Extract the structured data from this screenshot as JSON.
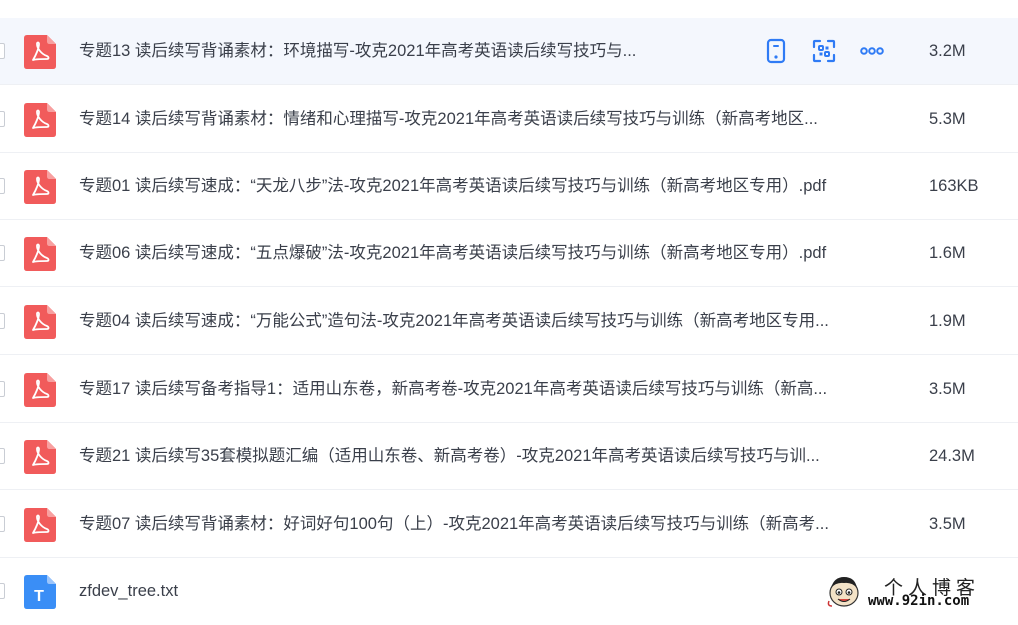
{
  "files": [
    {
      "name": "专题13 读后续写背诵素材：环境描写-攻克2021年高考英语读后续写技巧与...",
      "size": "3.2M",
      "icon": "pdf-icon"
    },
    {
      "name": "专题14 读后续写背诵素材：情绪和心理描写-攻克2021年高考英语读后续写技巧与训练（新高考地区...",
      "size": "5.3M",
      "icon": "pdf-icon"
    },
    {
      "name": "专题01 读后续写速成：“天龙八步”法-攻克2021年高考英语读后续写技巧与训练（新高考地区专用）.pdf",
      "size": "163KB",
      "icon": "pdf-icon"
    },
    {
      "name": "专题06 读后续写速成：“五点爆破”法-攻克2021年高考英语读后续写技巧与训练（新高考地区专用）.pdf",
      "size": "1.6M",
      "icon": "pdf-icon"
    },
    {
      "name": "专题04 读后续写速成：“万能公式”造句法-攻克2021年高考英语读后续写技巧与训练（新高考地区专用...",
      "size": "1.9M",
      "icon": "pdf-icon"
    },
    {
      "name": "专题17 读后续写备考指导1：适用山东卷，新高考卷-攻克2021年高考英语读后续写技巧与训练（新高...",
      "size": "3.5M",
      "icon": "pdf-icon"
    },
    {
      "name": "专题21 读后续写35套模拟题汇编（适用山东卷、新高考卷）-攻克2021年高考英语读后续写技巧与训...",
      "size": "24.3M",
      "icon": "pdf-icon"
    },
    {
      "name": "专题07 读后续写背诵素材：好词好句100句（上）-攻克2021年高考英语读后续写技巧与训练（新高考...",
      "size": "3.5M",
      "icon": "pdf-icon"
    },
    {
      "name": "zfdev_tree.txt",
      "size": "",
      "icon": "txt-icon",
      "icon_letter": "T"
    }
  ],
  "row_actions": [
    "phone-icon",
    "qr-scan-icon",
    "more-icon"
  ],
  "watermark": {
    "title": "个人博客",
    "url": "www.92in.com"
  },
  "colors": {
    "pdf": "#f15b5b",
    "txt": "#3a8ef6",
    "accent": "#2f7bf5",
    "hover_bg": "#f4f7fd"
  }
}
